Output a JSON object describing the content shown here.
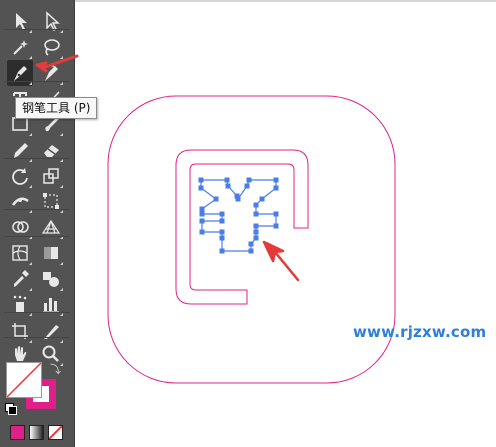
{
  "tooltip": {
    "text": "钢笔工具 (P)"
  },
  "watermark": {
    "text": "www.rjzxw.com"
  },
  "toolbar": {
    "tools": [
      {
        "name": "selection-tool-icon",
        "active": false
      },
      {
        "name": "direct-selection-tool-icon",
        "active": false
      },
      {
        "name": "magic-wand-tool-icon",
        "active": false
      },
      {
        "name": "lasso-tool-icon",
        "active": false
      },
      {
        "name": "pen-tool-icon",
        "active": true
      },
      {
        "name": "curvature-tool-icon",
        "active": false
      },
      {
        "name": "type-tool-icon",
        "active": false
      },
      {
        "name": "line-segment-tool-icon",
        "active": false
      },
      {
        "name": "rectangle-tool-icon",
        "active": false
      },
      {
        "name": "paintbrush-tool-icon",
        "active": false
      },
      {
        "name": "pencil-tool-icon",
        "active": false
      },
      {
        "name": "eraser-tool-icon",
        "active": false
      },
      {
        "name": "rotate-tool-icon",
        "active": false
      },
      {
        "name": "scale-tool-icon",
        "active": false
      },
      {
        "name": "width-tool-icon",
        "active": false
      },
      {
        "name": "free-transform-tool-icon",
        "active": false
      },
      {
        "name": "shape-builder-tool-icon",
        "active": false
      },
      {
        "name": "perspective-grid-tool-icon",
        "active": false
      },
      {
        "name": "mesh-tool-icon",
        "active": false
      },
      {
        "name": "gradient-tool-icon",
        "active": false
      },
      {
        "name": "eyedropper-tool-icon",
        "active": false
      },
      {
        "name": "blend-tool-icon",
        "active": false
      },
      {
        "name": "symbol-sprayer-tool-icon",
        "active": false
      },
      {
        "name": "column-graph-tool-icon",
        "active": false
      },
      {
        "name": "artboard-tool-icon",
        "active": false
      },
      {
        "name": "slice-tool-icon",
        "active": false
      },
      {
        "name": "hand-tool-icon",
        "active": false
      },
      {
        "name": "zoom-tool-icon",
        "active": false
      }
    ]
  },
  "colors": {
    "toolbar_bg": "#535353",
    "shape_stroke": "#e0208a",
    "path_stroke": "#4a7ee6",
    "arrow": "#e53a3a",
    "fill_swatch": "#ffffff",
    "stroke_swatch": "#e0208a",
    "watermark": "#2f7fd8"
  }
}
